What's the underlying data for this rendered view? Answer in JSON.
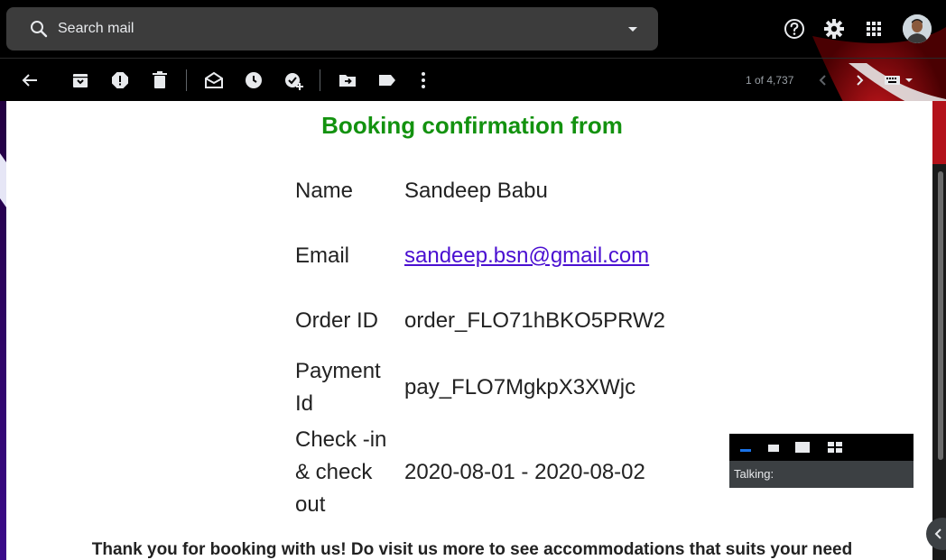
{
  "search": {
    "placeholder": "Search mail"
  },
  "top_icons": [
    "help-icon",
    "settings-gear-icon",
    "apps-grid-icon",
    "account-avatar"
  ],
  "toolbar": {
    "icons": [
      "back-arrow-icon",
      "archive-icon",
      "report-spam-icon",
      "delete-icon",
      "mark-unread-icon",
      "snooze-icon",
      "add-to-tasks-icon",
      "move-to-icon",
      "label-icon",
      "more-vert-icon"
    ],
    "pager_text": "1 of 4,737",
    "input_tools_icon": "keyboard-icon"
  },
  "email": {
    "heading": "Booking confirmation from",
    "rows": [
      {
        "label": "Name",
        "value": "Sandeep Babu"
      },
      {
        "label": "Email",
        "value": "sandeep.bsn@gmail.com"
      },
      {
        "label": "Order ID",
        "value": "order_FLO71hBKO5PRW2"
      },
      {
        "label": "Payment Id",
        "value": "pay_FLO7MgkpX3XWjc"
      },
      {
        "label": "Check -in & check out",
        "value": "2020-08-01 - 2020-08-02"
      }
    ],
    "thanks": "Thank you for booking with us! Do visit us more to see accommodations that suits your need"
  },
  "talk_widget": {
    "label": "Talking:"
  },
  "colors": {
    "heading_green": "#13920f",
    "link_purple": "#4a0fd1",
    "search_bg": "#3c3c3c"
  }
}
